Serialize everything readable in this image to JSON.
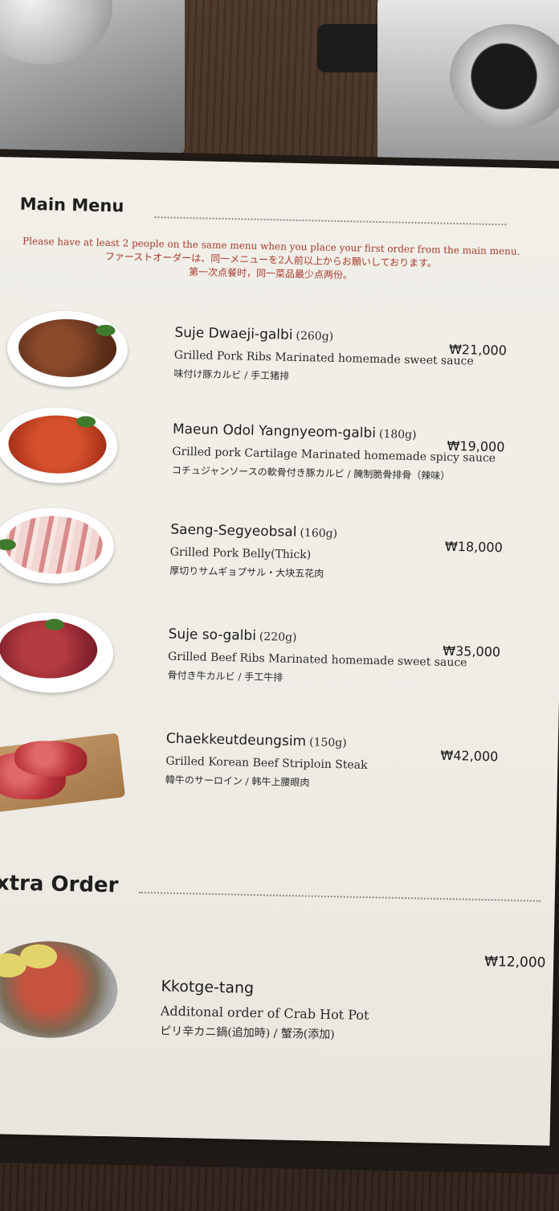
{
  "main_section": {
    "title": "Main Menu",
    "notice": {
      "en": "Please have at least 2 people on the same menu when you place your first order from the main menu.",
      "ja": "ファーストオーダーは、同一メニューを2人前以上からお願いしております。",
      "zh": "第一次点餐时，同一菜品最少点两份。"
    },
    "items": [
      {
        "name": "Suje Dwaeji-galbi",
        "weight": "(260g)",
        "price": "₩21,000",
        "description": "Grilled Pork Ribs Marinated homemade sweet sauce",
        "subtitle": "味付け豚カルビ / 手工猪排",
        "photo_icon": "pork-ribs-plate"
      },
      {
        "name": "Maeun Odol Yangnyeom-galbi",
        "weight": "(180g)",
        "price": "₩19,000",
        "description": "Grilled pork Cartilage Marinated homemade spicy sauce",
        "subtitle": "コチュジャンソースの軟骨付き豚カルビ / 腌制脆骨排骨（辣味）",
        "photo_icon": "spicy-pork-plate"
      },
      {
        "name": "Saeng-Segyeobsal",
        "weight": "(160g)",
        "price": "₩18,000",
        "description": "Grilled Pork Belly(Thick)",
        "subtitle": "厚切りサムギョプサル・大块五花肉",
        "photo_icon": "pork-belly-plate"
      },
      {
        "name": "Suje so-galbi",
        "weight": "(220g)",
        "price": "₩35,000",
        "description": "Grilled Beef Ribs Marinated homemade sweet sauce",
        "subtitle": "骨付き牛カルビ / 手工牛排",
        "photo_icon": "beef-ribs-plate"
      },
      {
        "name": "Chaekkeutdeungsim",
        "weight": "(150g)",
        "price": "₩42,000",
        "description": "Grilled Korean Beef Striploin Steak",
        "subtitle": "韓牛のサーロイン / 韩牛上腰眼肉",
        "photo_icon": "striploin-board"
      }
    ]
  },
  "extra_section": {
    "title": "Extra Order",
    "items": [
      {
        "name": "Kkotge-tang",
        "weight": "",
        "price": "₩12,000",
        "description": "Additonal order of Crab Hot Pot",
        "subtitle": "ピリ辛カニ鍋(追加時) / 蟹汤(添加)",
        "photo_icon": "crab-hot-pot"
      }
    ]
  },
  "colors": {
    "paper": "#efede6",
    "notice_red": "#a83a2e",
    "text": "#1c1c1c",
    "table_wood": "#3b2a1f"
  }
}
